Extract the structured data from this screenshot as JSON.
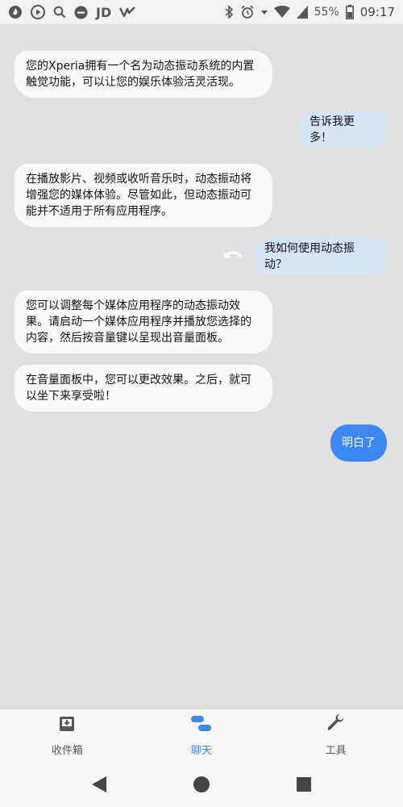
{
  "status_bar": {
    "left_icons": [
      "flame-app-icon",
      "play-store-icon",
      "search-icon",
      "do-not-disturb-icon",
      "jd-app-icon",
      "vn-app-icon"
    ],
    "jd_label": "JD",
    "battery_percent": "55%",
    "time": "09:17"
  },
  "chat": {
    "messages": [
      {
        "from": "bot",
        "text": "您的Xperia拥有一个名为动态振动系统的内置触觉功能，可以让您的娱乐体验活灵活现。"
      },
      {
        "from": "user",
        "text": "告诉我更多！"
      },
      {
        "from": "bot",
        "text": "在播放影片、视频或收听音乐时，动态振动将增强您的媒体体验。尽管如此，但动态振动可能并不适用于所有应用程序。"
      },
      {
        "from": "user",
        "text": "我如何使用动态振动？"
      },
      {
        "from": "bot",
        "text": "您可以调整每个媒体应用程序的动态振动效果。请启动一个媒体应用程序并播放您选择的内容，然后按音量键以呈现出音量面板。"
      },
      {
        "from": "bot",
        "text": "在音量面板中，您可以更改效果。之后，就可以坐下来享受啦！"
      }
    ],
    "reply_button": "明白了"
  },
  "bottom_nav": {
    "items": [
      {
        "label": "收件箱",
        "icon": "inbox-icon"
      },
      {
        "label": "聊天",
        "icon": "chat-icon",
        "active": true
      },
      {
        "label": "工具",
        "icon": "wrench-icon"
      }
    ]
  },
  "colors": {
    "accent": "#3d87f2",
    "user_bubble": "#d6e4f7",
    "bot_bubble": "#fafafa",
    "background": "#e0e0e0"
  }
}
